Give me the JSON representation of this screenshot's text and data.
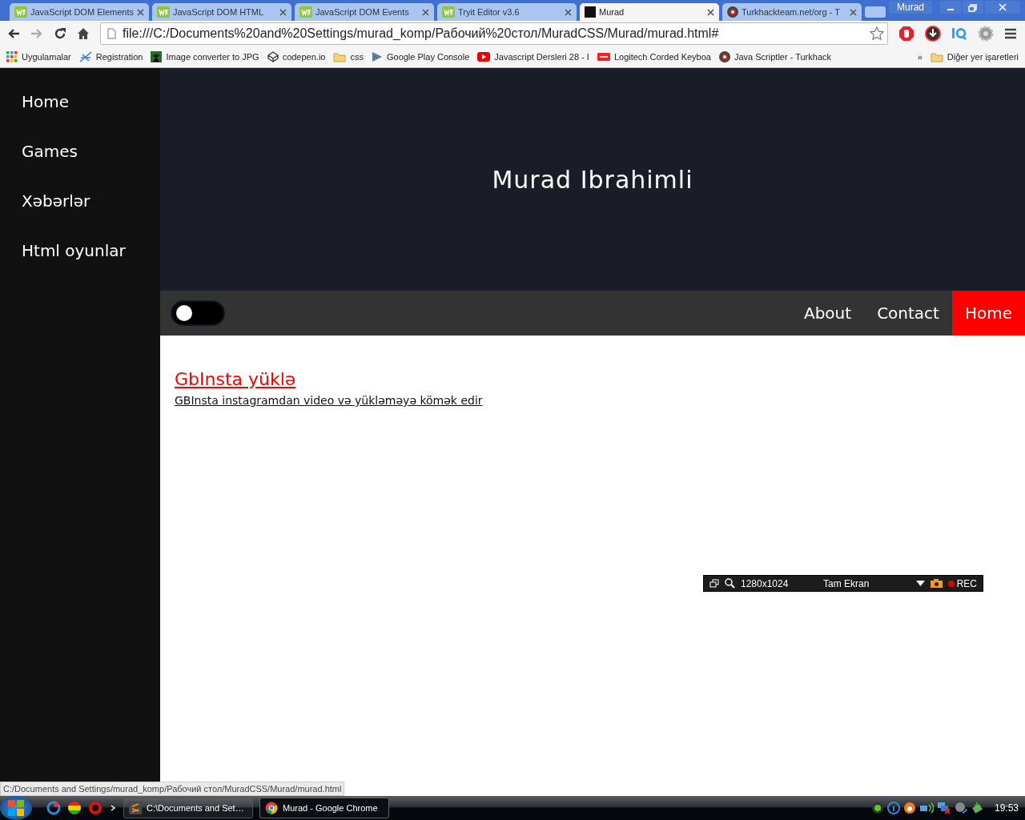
{
  "browser": {
    "tabs": [
      {
        "title": "JavaScript DOM Elements",
        "kind": "w3",
        "selected": false
      },
      {
        "title": "JavaScript DOM HTML",
        "kind": "w3",
        "selected": false
      },
      {
        "title": "JavaScript DOM Events",
        "kind": "w3",
        "selected": false
      },
      {
        "title": "Tryit Editor v3.6",
        "kind": "w3",
        "selected": false
      },
      {
        "title": "Murad",
        "kind": "dark",
        "selected": true
      },
      {
        "title": "Turkhackteam.net/org - T",
        "kind": "emblem",
        "selected": false
      }
    ],
    "profile": "Murad",
    "address": "file:///C:/Documents%20and%20Settings/murad_komp/Рабочий%20стол/MuradCSS/Murad/murad.html#",
    "bookmarks": [
      {
        "label": "Uygulamalar",
        "kind": "apps"
      },
      {
        "label": "Registration",
        "kind": "star"
      },
      {
        "label": "Image converter to JPG",
        "kind": "image"
      },
      {
        "label": "codepen.io",
        "kind": "cube"
      },
      {
        "label": "css",
        "kind": "folder"
      },
      {
        "label": "Google Play Console",
        "kind": "play"
      },
      {
        "label": "Javascript Dersleri 28 - I",
        "kind": "video"
      },
      {
        "label": "Logitech Corded Keyboa",
        "kind": "redtag"
      },
      {
        "label": "Java Scriptler - Turkhack",
        "kind": "emblem"
      }
    ],
    "overflow": "»",
    "other_bookmarks": "Diğer yer işaretleri"
  },
  "sidebar": {
    "items": [
      "Home",
      "Games",
      "Xəbərlər",
      "Html oyunlar"
    ]
  },
  "header": {
    "title": "Murad Ibrahimli"
  },
  "navbar": {
    "toggle": {
      "on": false
    },
    "links": [
      {
        "label": "About",
        "selected": false
      },
      {
        "label": "Contact",
        "selected": false
      },
      {
        "label": "Home",
        "selected": true
      }
    ]
  },
  "content": {
    "link": "GbInsta yüklə",
    "description": "GBInsta instagramdan video və yükləməyə kömək edir"
  },
  "status_url": "C:/Documents and Settings/murad_komp/Рабочий стол/MuradCSS/Murad/murad.html",
  "recorder": {
    "size": "1280x1024",
    "mode": "Tam Ekran",
    "rec": "REC"
  },
  "taskbar": {
    "items": [
      {
        "label": "C:\\Documents and Set…",
        "kind": "editor",
        "selected": false
      },
      {
        "label": "Murad - Google Chrome",
        "kind": "chrome",
        "selected": true
      }
    ],
    "clock": "19:53"
  }
}
